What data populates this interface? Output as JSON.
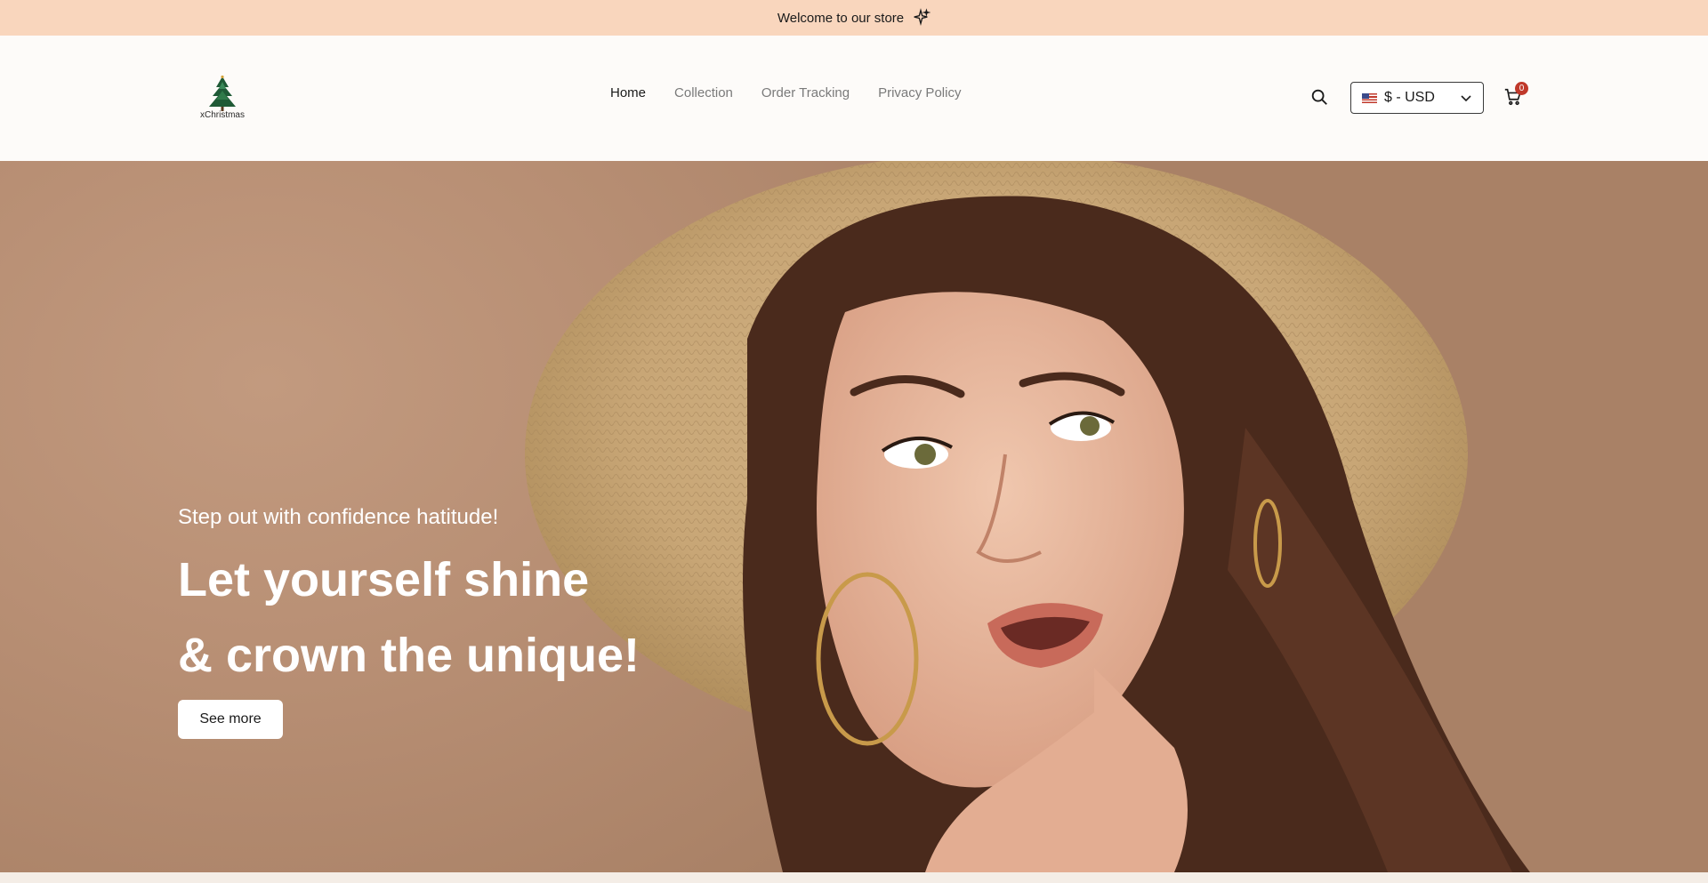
{
  "announcement": {
    "text": "Welcome to our store"
  },
  "brand": {
    "name": "xChristmas"
  },
  "nav": {
    "items": [
      {
        "label": "Home",
        "active": true
      },
      {
        "label": "Collection",
        "active": false
      },
      {
        "label": "Order Tracking",
        "active": false
      },
      {
        "label": "Privacy Policy",
        "active": false
      }
    ]
  },
  "header": {
    "currency_label": "$ - USD",
    "cart_count": "0"
  },
  "hero": {
    "subtitle": "Step out with confidence hatitude!",
    "title_line1": "Let yourself shine",
    "title_line2": "& crown the unique!",
    "cta_label": "See more"
  },
  "colors": {
    "announcement_bg": "#f9d6bd",
    "hero_bg": "#b88f74",
    "badge": "#c0392b"
  },
  "icons": [
    "sparkle-icon",
    "search-icon",
    "flag-us-icon",
    "chevron-down-icon",
    "cart-icon",
    "tree-logo-icon"
  ]
}
